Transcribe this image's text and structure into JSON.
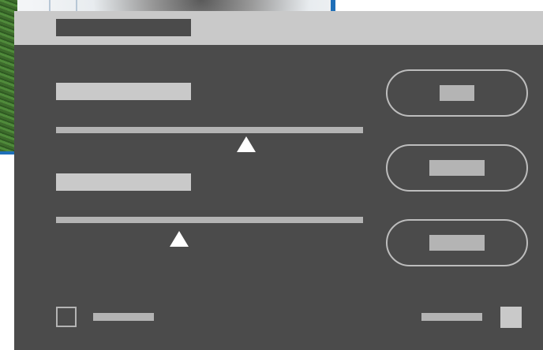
{
  "background": {
    "description_icon": "photo-background"
  },
  "dialog": {
    "title": "",
    "sliders": [
      {
        "label": "",
        "value_fraction": 0.62
      },
      {
        "label": "",
        "value_fraction": 0.4
      }
    ],
    "buttons": [
      {
        "label": ""
      },
      {
        "label": ""
      },
      {
        "label": ""
      }
    ],
    "checkbox": {
      "label": "",
      "checked": false
    },
    "footer_right": {
      "label": ""
    }
  },
  "colors": {
    "dialog_bg": "#4b4b4b",
    "titlebar_bg": "#c9c9c9",
    "control_gray": "#b4b4b4",
    "thumb": "#ffffff",
    "accent_blue": "#1f6fb8"
  }
}
